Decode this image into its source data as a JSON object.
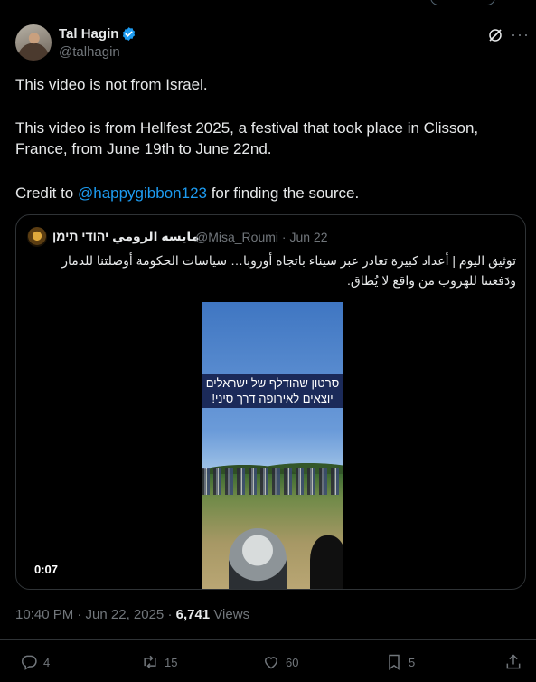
{
  "author": {
    "name": "Tal Hagin",
    "handle": "@talhagin"
  },
  "tweet": {
    "line1": "This video is not from Israel.",
    "line2": "This video is from Hellfest 2025, a festival that took place in Clisson,",
    "line3": "France, from June 19th to June 22nd.",
    "credit_prefix": "Credit to ",
    "credit_mention": "@happygibbon123",
    "credit_suffix": " for finding the source."
  },
  "quote": {
    "name": "مايسه الرومي יהודי תימן",
    "handle_date": "@Misa_Roumi · Jun 22",
    "text_line1": "توثيق اليوم | أعداد كبيرة تغادر عبر سيناء باتجاه أوروبا… سياسات الحكومة أوصلتنا للدمار",
    "text_line2": "ودَفعتنا للهروب من واقع لا يُطاق.",
    "video_caption_line1": "סרטון שהודלף של ישראלים",
    "video_caption_line2": "יוצאים לאירופה דרך סיני!",
    "video_duration": "0:07"
  },
  "meta": {
    "time_date": "10:40 PM · Jun 22, 2025 · ",
    "views_count": "6,741",
    "views_label": " Views"
  },
  "actions": {
    "replies": "4",
    "reposts": "15",
    "likes": "60",
    "bookmarks": "5"
  },
  "colors": {
    "background": "#000000",
    "text": "#e7e9ea",
    "muted": "#71767b",
    "accent": "#1d9bf0",
    "border": "#2f3336"
  }
}
